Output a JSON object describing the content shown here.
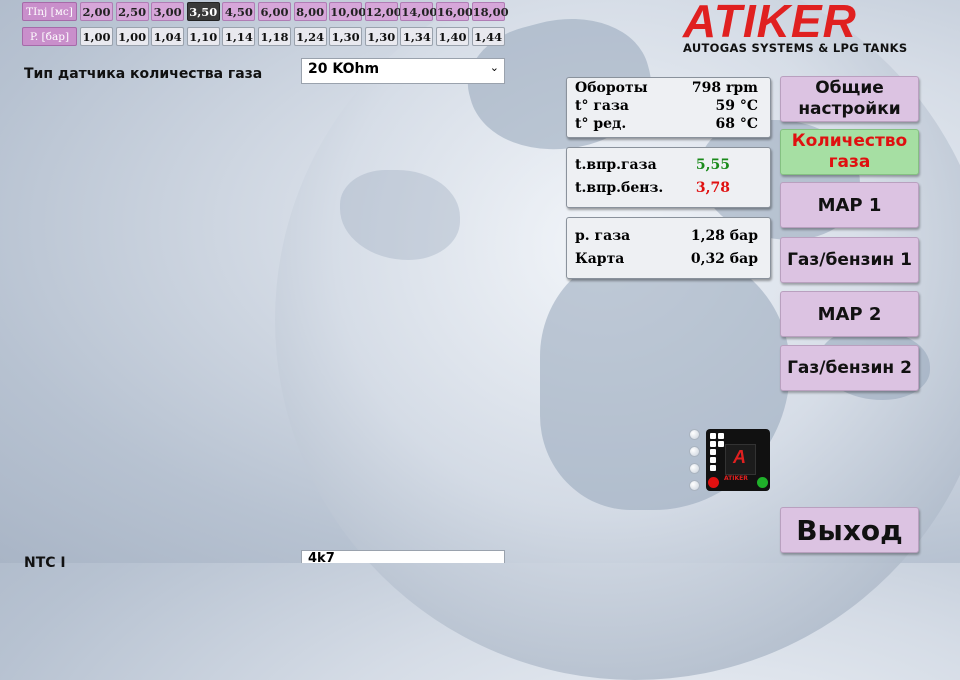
{
  "table": {
    "tinj_label": "TInj [мс]",
    "tinj": [
      "2,00",
      "2,50",
      "3,00",
      "3,50",
      "4,50",
      "6,00",
      "8,00",
      "10,00",
      "12,00",
      "14,00",
      "16,00",
      "18,00"
    ],
    "tinj_selected_index": 3,
    "p_label": "P. [бар]",
    "p": [
      "1,00",
      "1,00",
      "1,04",
      "1,10",
      "1,14",
      "1,18",
      "1,24",
      "1,30",
      "1,30",
      "1,34",
      "1,40",
      "1,44"
    ]
  },
  "settings": {
    "gas_sensor_label": "Тип датчика количества газа",
    "gas_sensor_value": "20 KOhm",
    "ntc_label": "NTC I",
    "ntc_value": "4k7"
  },
  "panel1": {
    "rpm_label": "Обороты",
    "rpm_value": "798 rpm",
    "gas_t_label": "t° газа",
    "gas_t_value": "59 °C",
    "red_t_label": "t° ред.",
    "red_t_value": "68 °C"
  },
  "panel2": {
    "inj_gas_label": "t.впр.газа",
    "inj_gas_value": "5,55",
    "inj_pet_label": "t.впр.бенз.",
    "inj_pet_value": "3,78"
  },
  "panel3": {
    "p_gas_label": "р. газа",
    "p_gas_value": "1,28 бар",
    "map_label": "Карта",
    "map_value": "0,32 бар"
  },
  "nav": {
    "general": "Общие настройки",
    "gas_quantity": "Количество газа",
    "map1": "MAP 1",
    "gas_petrol1": "Газ/бензин 1",
    "map2": "MAP 2",
    "gas_petrol2": "Газ/бензин 2",
    "exit": "Выход"
  },
  "logo": {
    "name": "ATIKER",
    "tagline": "AUTOGAS SYSTEMS & LPG TANKS"
  },
  "device": {
    "mark": "A",
    "brand": "ATIKER"
  },
  "colors": {
    "accent_red": "#e02020",
    "value_green": "#1a8a1a",
    "value_red": "#e01010",
    "button_purple": "#dcc3e2",
    "button_active_green": "#a6dfa3"
  }
}
